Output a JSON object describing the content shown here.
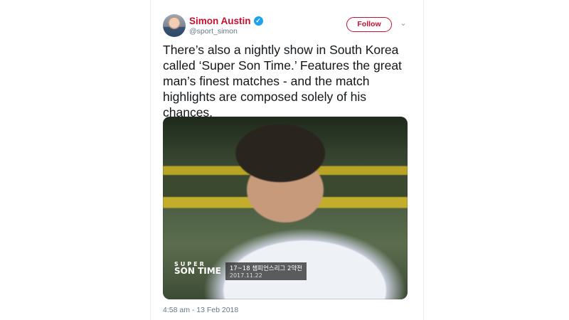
{
  "tweet": {
    "author_name": "Simon Austin",
    "author_handle": "@sport_simon",
    "follow_label": "Follow",
    "text": "There’s also a nightly show in South Korea called ‘Super Son Time.’ Features the great man’s finest matches - and the match highlights are composed solely of his chances.",
    "timestamp": "4:58 am - 13 Feb 2018",
    "accent_color": "#c8102e",
    "verified_badge_color": "#1da1f2",
    "icons": [
      "verified-icon",
      "chevron-down-icon"
    ]
  },
  "media": {
    "overlay_logo_top": "SUPER",
    "overlay_logo_bottom": "SON TIME",
    "overlay_title": "17~18 챔피언스리그 2약전",
    "overlay_date": "2017.11.22"
  }
}
